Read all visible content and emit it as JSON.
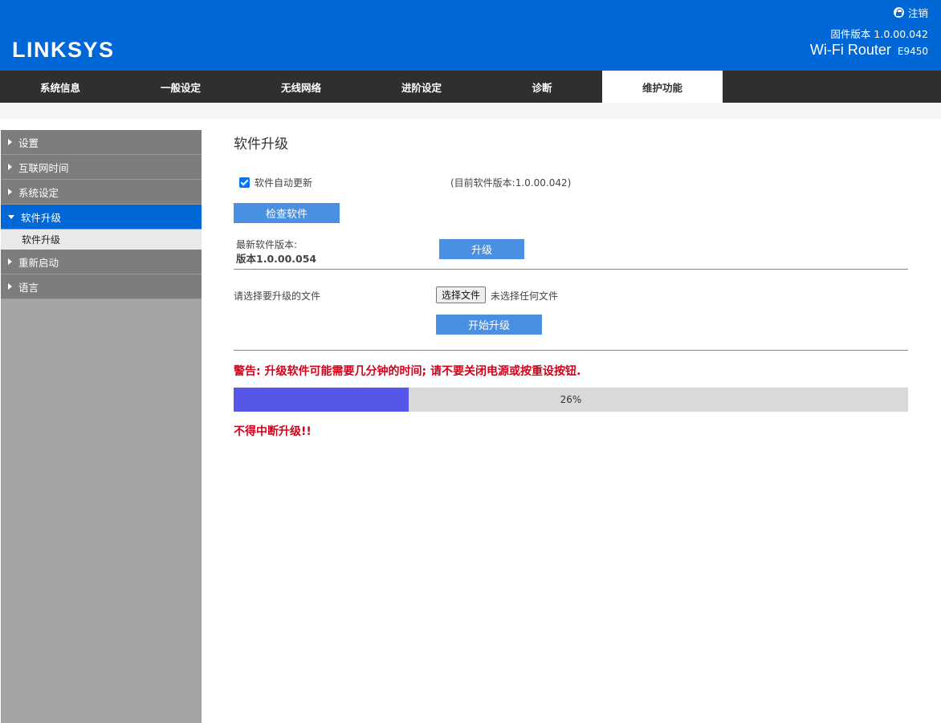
{
  "header": {
    "logo": "LINKSYS",
    "logout_label": "注销",
    "firmware_version": "固件版本 1.0.00.042",
    "router_title": "Wi-Fi Router",
    "router_model": "E9450"
  },
  "topnav": {
    "tabs": [
      {
        "label": "系统信息"
      },
      {
        "label": "一般设定"
      },
      {
        "label": "无线网络"
      },
      {
        "label": "进阶设定"
      },
      {
        "label": "诊断"
      },
      {
        "label": "维护功能",
        "active": true
      }
    ]
  },
  "sidebar": {
    "items": [
      {
        "label": "设置"
      },
      {
        "label": "互联网时间"
      },
      {
        "label": "系统设定"
      },
      {
        "label": "软件升级",
        "active": true
      },
      {
        "label": "重新启动"
      },
      {
        "label": "语言"
      }
    ],
    "subitem": "软件升级"
  },
  "main": {
    "title": "软件升级",
    "auto_update_label": "软件自动更新",
    "auto_update_checked": true,
    "current_version": "(目前软件版本:1.0.00.042)",
    "check_button": "检查软件",
    "latest_label": "最新软件版本:",
    "latest_value": "版本1.0.00.054",
    "upgrade_button": "升级",
    "file_label": "请选择要升级的文件",
    "choose_file_button": "选择文件",
    "no_file_text": "未选择任何文件",
    "start_button": "开始升级",
    "warning": "警告: 升级软件可能需要几分钟的时间; 请不要关闭电源或按重设按钮.",
    "progress_percent": 26,
    "progress_text": "26%",
    "no_interrupt": "不得中断升级!!"
  },
  "colors": {
    "header_bg": "#0067d6",
    "nav_bg": "#2f2f2f",
    "button_bg": "#4a90e2",
    "progress_fill": "#5656e8",
    "warning": "#d0021b"
  }
}
